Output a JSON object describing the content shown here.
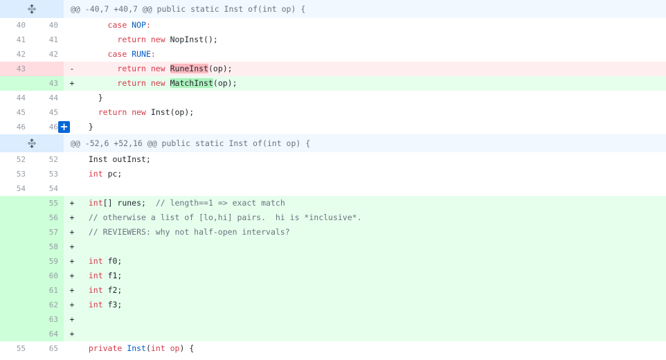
{
  "hunks": [
    {
      "header": "@@ -40,7 +40,7 @@ public static Inst of(int op) {",
      "lines": [
        {
          "type": "ctx",
          "old": "40",
          "new": "40",
          "marker": " ",
          "tokens": [
            {
              "t": "      "
            },
            {
              "t": "case",
              "c": "kw"
            },
            {
              "t": " "
            },
            {
              "t": "NOP",
              "c": "cn"
            },
            {
              "t": ":",
              "c": "kw"
            }
          ]
        },
        {
          "type": "ctx",
          "old": "41",
          "new": "41",
          "marker": " ",
          "tokens": [
            {
              "t": "        "
            },
            {
              "t": "return",
              "c": "kw"
            },
            {
              "t": " "
            },
            {
              "t": "new",
              "c": "kw"
            },
            {
              "t": " NopInst();"
            }
          ]
        },
        {
          "type": "ctx",
          "old": "42",
          "new": "42",
          "marker": " ",
          "tokens": [
            {
              "t": "      "
            },
            {
              "t": "case",
              "c": "kw"
            },
            {
              "t": " "
            },
            {
              "t": "RUNE",
              "c": "cn"
            },
            {
              "t": ":",
              "c": "kw"
            }
          ]
        },
        {
          "type": "del",
          "old": "43",
          "new": "",
          "marker": "-",
          "tokens": [
            {
              "t": "        "
            },
            {
              "t": "return",
              "c": "kw"
            },
            {
              "t": " "
            },
            {
              "t": "new",
              "c": "kw"
            },
            {
              "t": " "
            },
            {
              "t": "RuneInst",
              "c": "hl-del"
            },
            {
              "t": "(op);"
            }
          ]
        },
        {
          "type": "add",
          "old": "",
          "new": "43",
          "marker": "+",
          "tokens": [
            {
              "t": "        "
            },
            {
              "t": "return",
              "c": "kw"
            },
            {
              "t": " "
            },
            {
              "t": "new",
              "c": "kw"
            },
            {
              "t": " "
            },
            {
              "t": "MatchInst",
              "c": "hl-add"
            },
            {
              "t": "(op);"
            }
          ]
        },
        {
          "type": "ctx",
          "old": "44",
          "new": "44",
          "marker": " ",
          "tokens": [
            {
              "t": "    }"
            }
          ]
        },
        {
          "type": "ctx",
          "old": "45",
          "new": "45",
          "marker": " ",
          "tokens": [
            {
              "t": "    "
            },
            {
              "t": "return",
              "c": "kw"
            },
            {
              "t": " "
            },
            {
              "t": "new",
              "c": "kw"
            },
            {
              "t": " Inst(op);"
            }
          ]
        },
        {
          "type": "ctx",
          "old": "46",
          "new": "46",
          "marker": " ",
          "comment_button": "+",
          "tokens": [
            {
              "t": "  }"
            }
          ]
        }
      ]
    },
    {
      "header": "@@ -52,6 +52,16 @@ public static Inst of(int op) {",
      "lines": [
        {
          "type": "ctx",
          "old": "52",
          "new": "52",
          "marker": " ",
          "tokens": [
            {
              "t": "  Inst outInst;"
            }
          ]
        },
        {
          "type": "ctx",
          "old": "53",
          "new": "53",
          "marker": " ",
          "tokens": [
            {
              "t": "  "
            },
            {
              "t": "int",
              "c": "ty"
            },
            {
              "t": " pc;"
            }
          ]
        },
        {
          "type": "ctx",
          "old": "54",
          "new": "54",
          "marker": " ",
          "tokens": [
            {
              "t": ""
            }
          ]
        },
        {
          "type": "add",
          "old": "",
          "new": "55",
          "marker": "+",
          "tokens": [
            {
              "t": "  "
            },
            {
              "t": "int",
              "c": "ty"
            },
            {
              "t": "[] runes;  "
            },
            {
              "t": "// length==1 => exact match",
              "c": "cm"
            }
          ]
        },
        {
          "type": "add",
          "old": "",
          "new": "56",
          "marker": "+",
          "tokens": [
            {
              "t": "  "
            },
            {
              "t": "// otherwise a list of [lo,hi] pairs.  hi is *inclusive*.",
              "c": "cm"
            }
          ]
        },
        {
          "type": "add",
          "old": "",
          "new": "57",
          "marker": "+",
          "tokens": [
            {
              "t": "  "
            },
            {
              "t": "// REVIEWERS: why not half-open intervals?",
              "c": "cm"
            }
          ]
        },
        {
          "type": "add",
          "old": "",
          "new": "58",
          "marker": "+",
          "tokens": [
            {
              "t": ""
            }
          ]
        },
        {
          "type": "add",
          "old": "",
          "new": "59",
          "marker": "+",
          "tokens": [
            {
              "t": "  "
            },
            {
              "t": "int",
              "c": "ty"
            },
            {
              "t": " f0;"
            }
          ]
        },
        {
          "type": "add",
          "old": "",
          "new": "60",
          "marker": "+",
          "tokens": [
            {
              "t": "  "
            },
            {
              "t": "int",
              "c": "ty"
            },
            {
              "t": " f1;"
            }
          ]
        },
        {
          "type": "add",
          "old": "",
          "new": "61",
          "marker": "+",
          "tokens": [
            {
              "t": "  "
            },
            {
              "t": "int",
              "c": "ty"
            },
            {
              "t": " f2;"
            }
          ]
        },
        {
          "type": "add",
          "old": "",
          "new": "62",
          "marker": "+",
          "tokens": [
            {
              "t": "  "
            },
            {
              "t": "int",
              "c": "ty"
            },
            {
              "t": " f3;"
            }
          ]
        },
        {
          "type": "add",
          "old": "",
          "new": "63",
          "marker": "+",
          "tokens": [
            {
              "t": ""
            }
          ]
        },
        {
          "type": "add",
          "old": "",
          "new": "64",
          "marker": "+",
          "tokens": [
            {
              "t": ""
            }
          ]
        },
        {
          "type": "ctx",
          "old": "55",
          "new": "65",
          "marker": " ",
          "tokens": [
            {
              "t": "  "
            },
            {
              "t": "private",
              "c": "kw"
            },
            {
              "t": " "
            },
            {
              "t": "Inst",
              "c": "cn"
            },
            {
              "t": "("
            },
            {
              "t": "int",
              "c": "kw"
            },
            {
              "t": " "
            },
            {
              "t": "op",
              "c": "kw"
            },
            {
              "t": ") {"
            }
          ]
        }
      ]
    }
  ],
  "icons": {
    "expand": "unfold-icon",
    "add_comment": "plus-icon"
  },
  "colors": {
    "hunk_bg": "#f1f8ff",
    "add_bg": "#e6ffed",
    "del_bg": "#ffeef0",
    "accent": "#0366d6"
  }
}
